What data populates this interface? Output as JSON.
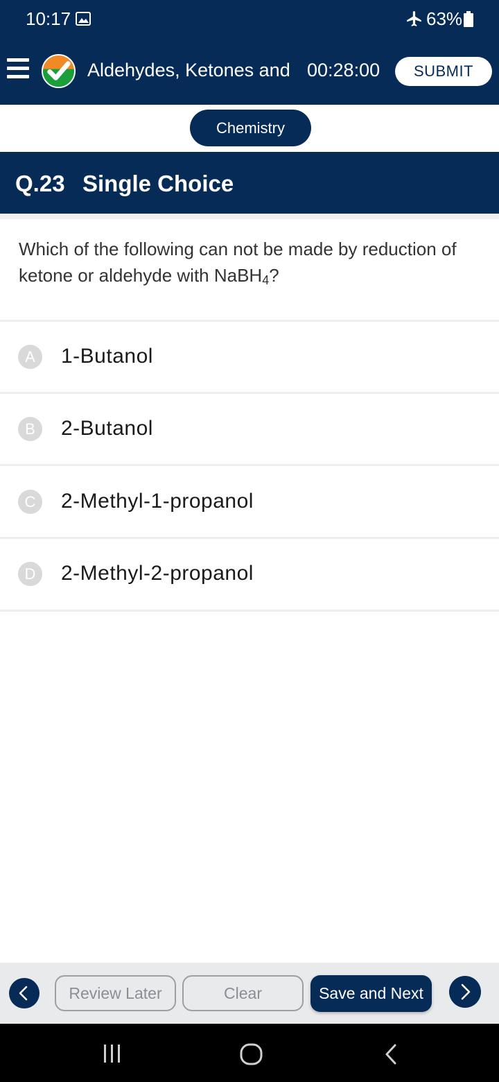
{
  "status_bar": {
    "time": "10:17",
    "battery": "63%",
    "icons": [
      "gallery-icon",
      "airplane-mode-icon",
      "battery-icon"
    ]
  },
  "app_bar": {
    "title": "Aldehydes, Ketones and",
    "timer": "00:28:00",
    "submit_label": "SUBMIT",
    "icons": [
      "menu-icon",
      "checkmark-logo-icon"
    ]
  },
  "subject": "Chemistry",
  "question": {
    "number": "Q.23",
    "type": "Single Choice",
    "text_before": "Which of the following can not be made by reduction of ketone or aldehyde with NaBH",
    "subscript": "4",
    "text_after": "?"
  },
  "options": [
    {
      "letter": "A",
      "label": "1-Butanol"
    },
    {
      "letter": "B",
      "label": "2-Butanol"
    },
    {
      "letter": "C",
      "label": "2-Methyl-1-propanol"
    },
    {
      "letter": "D",
      "label": "2-Methyl-2-propanol"
    }
  ],
  "bottom_bar": {
    "review_label": "Review Later",
    "clear_label": "Clear",
    "save_label": "Save and Next",
    "icons": [
      "chevron-left-icon",
      "chevron-right-icon"
    ]
  },
  "system_nav": {
    "icons": [
      "recent-apps-icon",
      "home-icon",
      "back-icon"
    ]
  },
  "colors": {
    "primary_navy": "#062b57",
    "option_badge": "#d9d9d9",
    "bottom_bar_bg": "#e9eaec"
  }
}
